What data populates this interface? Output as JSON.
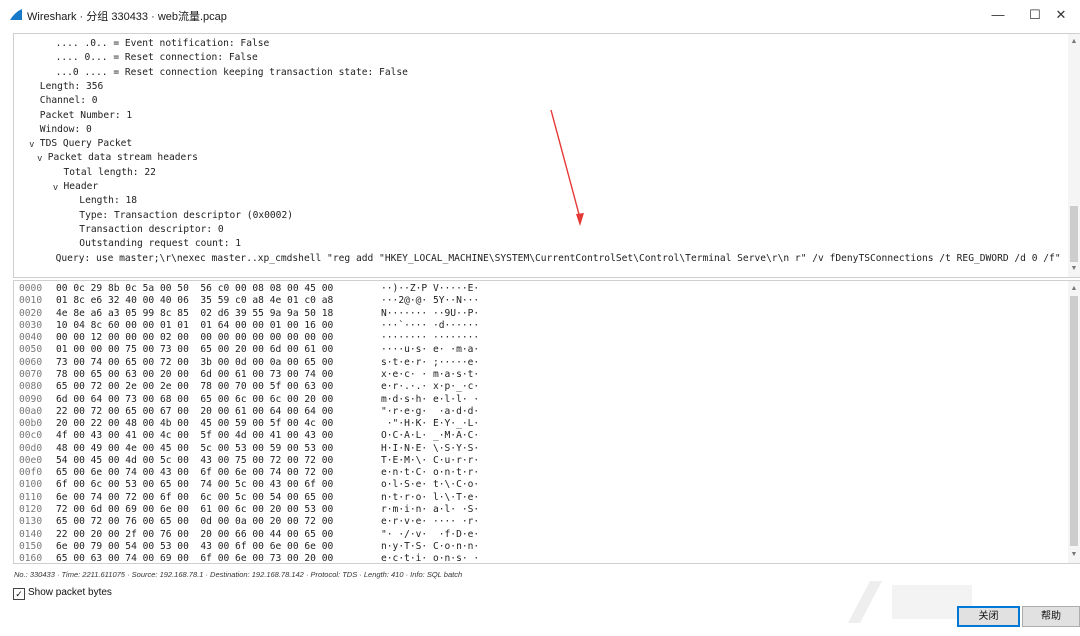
{
  "window": {
    "title": "Wireshark · 分组 330433 · web流量.pcap",
    "minimize_glyph": "—",
    "maximize_glyph": "☐",
    "close_glyph": "✕",
    "app_icon": "shark-fin-icon"
  },
  "detail_tree": [
    {
      "indent": 4,
      "caret": "",
      "text": ".... .0.. = Event notification: False"
    },
    {
      "indent": 4,
      "caret": "",
      "text": ".... 0... = Reset connection: False"
    },
    {
      "indent": 4,
      "caret": "",
      "text": "...0 .... = Reset connection keeping transaction state: False"
    },
    {
      "indent": 2,
      "caret": "",
      "text": "Length: 356"
    },
    {
      "indent": 2,
      "caret": "",
      "text": "Channel: 0"
    },
    {
      "indent": 2,
      "caret": "",
      "text": "Packet Number: 1"
    },
    {
      "indent": 2,
      "caret": "",
      "text": "Window: 0"
    },
    {
      "indent": 2,
      "caret": "v",
      "text": "TDS Query Packet"
    },
    {
      "indent": 3,
      "caret": "v",
      "text": "Packet data stream headers"
    },
    {
      "indent": 5,
      "caret": "",
      "text": "Total length: 22"
    },
    {
      "indent": 5,
      "caret": "v",
      "text": "Header"
    },
    {
      "indent": 7,
      "caret": "",
      "text": "Length: 18"
    },
    {
      "indent": 7,
      "caret": "",
      "text": "Type: Transaction descriptor (0x0002)"
    },
    {
      "indent": 7,
      "caret": "",
      "text": "Transaction descriptor: 0"
    },
    {
      "indent": 7,
      "caret": "",
      "text": "Outstanding request count: 1"
    },
    {
      "indent": 4,
      "caret": "",
      "text": "Query: use master;\\r\\nexec master..xp_cmdshell \"reg add \"HKEY_LOCAL_MACHINE\\SYSTEM\\CurrentControlSet\\Control\\Terminal Serve\\r\\n r\" /v fDenyTSConnections /t REG_DWORD /d 0 /f\""
    }
  ],
  "hex_dump": [
    {
      "offset": "0000",
      "hex": "00 0c 29 8b 0c 5a 00 50  56 c0 00 08 08 00 45 00",
      "ascii": "··)··Z·P V·····E·"
    },
    {
      "offset": "0010",
      "hex": "01 8c e6 32 40 00 40 06  35 59 c0 a8 4e 01 c0 a8",
      "ascii": "···2@·@· 5Y··N···"
    },
    {
      "offset": "0020",
      "hex": "4e 8e a6 a3 05 99 8c 85  02 d6 39 55 9a 9a 50 18",
      "ascii": "N······· ··9U··P·"
    },
    {
      "offset": "0030",
      "hex": "10 04 8c 60 00 00 01 01  01 64 00 00 01 00 16 00",
      "ascii": "···`···· ·d······"
    },
    {
      "offset": "0040",
      "hex": "00 00 12 00 00 00 02 00  00 00 00 00 00 00 00 00",
      "ascii": "········ ········"
    },
    {
      "offset": "0050",
      "hex": "01 00 00 00 75 00 73 00  65 00 20 00 6d 00 61 00",
      "ascii": "····u·s· e· ·m·a·"
    },
    {
      "offset": "0060",
      "hex": "73 00 74 00 65 00 72 00  3b 00 0d 00 0a 00 65 00",
      "ascii": "s·t·e·r· ;·····e·"
    },
    {
      "offset": "0070",
      "hex": "78 00 65 00 63 00 20 00  6d 00 61 00 73 00 74 00",
      "ascii": "x·e·c· · m·a·s·t·"
    },
    {
      "offset": "0080",
      "hex": "65 00 72 00 2e 00 2e 00  78 00 70 00 5f 00 63 00",
      "ascii": "e·r·.·.· x·p·_·c·"
    },
    {
      "offset": "0090",
      "hex": "6d 00 64 00 73 00 68 00  65 00 6c 00 6c 00 20 00",
      "ascii": "m·d·s·h· e·l·l· ·"
    },
    {
      "offset": "00a0",
      "hex": "22 00 72 00 65 00 67 00  20 00 61 00 64 00 64 00",
      "ascii": "\"·r·e·g·  ·a·d·d·"
    },
    {
      "offset": "00b0",
      "hex": "20 00 22 00 48 00 4b 00  45 00 59 00 5f 00 4c 00",
      "ascii": " ·\"·H·K· E·Y·_·L·"
    },
    {
      "offset": "00c0",
      "hex": "4f 00 43 00 41 00 4c 00  5f 00 4d 00 41 00 43 00",
      "ascii": "O·C·A·L· _·M·A·C·"
    },
    {
      "offset": "00d0",
      "hex": "48 00 49 00 4e 00 45 00  5c 00 53 00 59 00 53 00",
      "ascii": "H·I·N·E· \\·S·Y·S·"
    },
    {
      "offset": "00e0",
      "hex": "54 00 45 00 4d 00 5c 00  43 00 75 00 72 00 72 00",
      "ascii": "T·E·M·\\· C·u·r·r·"
    },
    {
      "offset": "00f0",
      "hex": "65 00 6e 00 74 00 43 00  6f 00 6e 00 74 00 72 00",
      "ascii": "e·n·t·C· o·n·t·r·"
    },
    {
      "offset": "0100",
      "hex": "6f 00 6c 00 53 00 65 00  74 00 5c 00 43 00 6f 00",
      "ascii": "o·l·S·e· t·\\·C·o·"
    },
    {
      "offset": "0110",
      "hex": "6e 00 74 00 72 00 6f 00  6c 00 5c 00 54 00 65 00",
      "ascii": "n·t·r·o· l·\\·T·e·"
    },
    {
      "offset": "0120",
      "hex": "72 00 6d 00 69 00 6e 00  61 00 6c 00 20 00 53 00",
      "ascii": "r·m·i·n· a·l· ·S·"
    },
    {
      "offset": "0130",
      "hex": "65 00 72 00 76 00 65 00  0d 00 0a 00 20 00 72 00",
      "ascii": "e·r·v·e· ···· ·r·"
    },
    {
      "offset": "0140",
      "hex": "22 00 20 00 2f 00 76 00  20 00 66 00 44 00 65 00",
      "ascii": "\"· ·/·v·  ·f·D·e·"
    },
    {
      "offset": "0150",
      "hex": "6e 00 79 00 54 00 53 00  43 00 6f 00 6e 00 6e 00",
      "ascii": "n·y·T·S· C·o·n·n·"
    },
    {
      "offset": "0160",
      "hex": "65 00 63 00 74 00 69 00  6f 00 6e 00 73 00 20 00",
      "ascii": "e·c·t·i· o·n·s· ·"
    }
  ],
  "status_bar": {
    "text": "No.: 330433 · Time: 2211.611075 · Source: 192.168.78.1 · Destination: 192.168.78.142 · Protocol: TDS · Length: 410 · Info: SQL batch"
  },
  "options": {
    "show_packet_bytes_label": "Show packet bytes",
    "show_packet_bytes_checked": true,
    "check_glyph": "✓"
  },
  "buttons": {
    "close_label": "关闭",
    "help_label": "帮助"
  },
  "scroll_glyphs": {
    "up": "▲",
    "down": "▼"
  },
  "colors": {
    "annotation_arrow": "#e53935",
    "brand": "#1679c9",
    "primary_button_border": "#0078d7"
  }
}
